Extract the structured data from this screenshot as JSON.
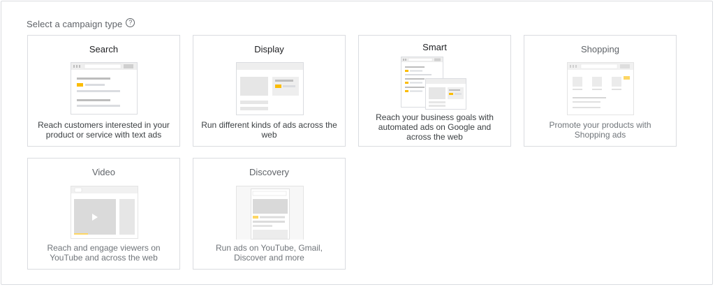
{
  "heading": {
    "label": "Select a campaign type",
    "help_icon": "help-circle-icon"
  },
  "colors": {
    "border": "#dadce0",
    "accent": "#fbbc04",
    "placeholder": "#dadce0"
  },
  "cards": [
    {
      "title": "Search",
      "description": "Reach customers interested in your product or service with text ads",
      "illustration": "search-illustration"
    },
    {
      "title": "Display",
      "description": "Run different kinds of ads across the web",
      "illustration": "display-illustration"
    },
    {
      "title": "Smart",
      "description": "Reach your business goals with automated ads on Google and across the web",
      "illustration": "smart-illustration"
    },
    {
      "title": "Shopping",
      "description": "Promote your products with Shopping ads",
      "illustration": "shopping-illustration"
    },
    {
      "title": "Video",
      "description": "Reach and engage viewers on YouTube and across the web",
      "illustration": "video-illustration"
    },
    {
      "title": "Discovery",
      "description": "Run ads on YouTube, Gmail, Discover and more",
      "illustration": "discovery-illustration"
    }
  ]
}
